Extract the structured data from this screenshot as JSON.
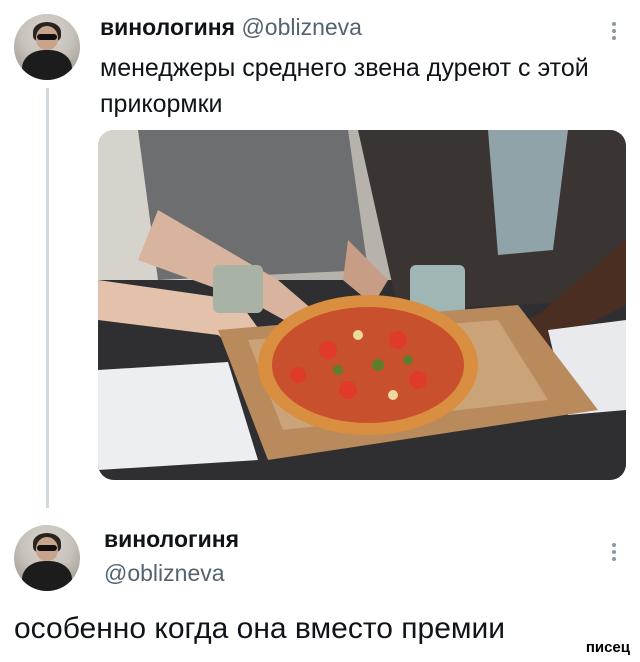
{
  "tweet1": {
    "author_name": "винологиня",
    "author_handle": "@oblizneva",
    "text": "менеджеры среднего звена дуреют с этой прикормки",
    "media_alt": "pizza-photo"
  },
  "tweet2": {
    "author_name": "винологиня",
    "author_handle": "@oblizneva",
    "text": "особенно когда она вместо премии"
  },
  "watermark": "писец",
  "icons": {
    "more": "more-vertical-icon"
  },
  "colors": {
    "handle": "#536471",
    "thread_line": "#cfd9de"
  }
}
